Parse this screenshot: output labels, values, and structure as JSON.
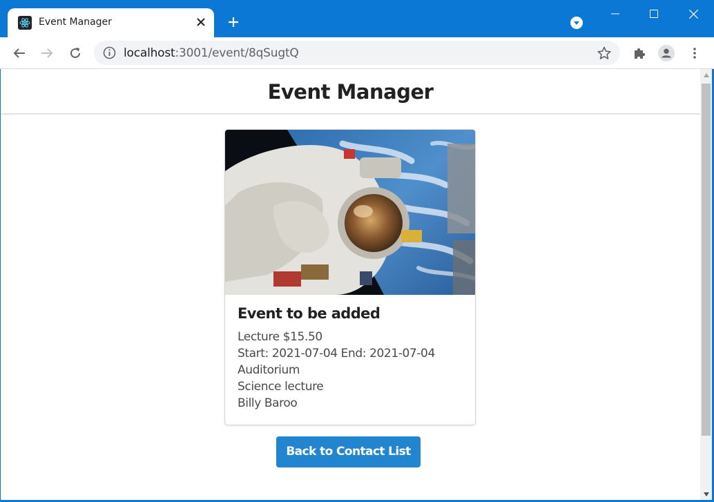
{
  "browser": {
    "tab_title": "Event Manager",
    "url_host": "localhost",
    "url_rest": ":3001/event/8qSugtQ",
    "icons": [
      "react-favicon-icon",
      "close-icon",
      "plus-icon",
      "profile-dot-icon",
      "minimize-icon",
      "maximize-icon",
      "window-close-icon",
      "back-arrow-icon",
      "forward-arrow-icon",
      "reload-icon",
      "info-icon",
      "star-icon",
      "extensions-icon",
      "account-icon",
      "menu-kebab-icon"
    ]
  },
  "colors": {
    "chrome_blue": "#0b78d6",
    "button_blue": "#2185d0"
  },
  "app": {
    "title": "Event Manager"
  },
  "event": {
    "name": "Event to be added",
    "type_price": "Lecture $15.50",
    "dates": "Start: 2021-07-04 End: 2021-07-04",
    "location": "Auditorium",
    "description": "Science lecture",
    "organizer": "Billy Baroo"
  },
  "actions": {
    "back_label": "Back to Contact List"
  }
}
